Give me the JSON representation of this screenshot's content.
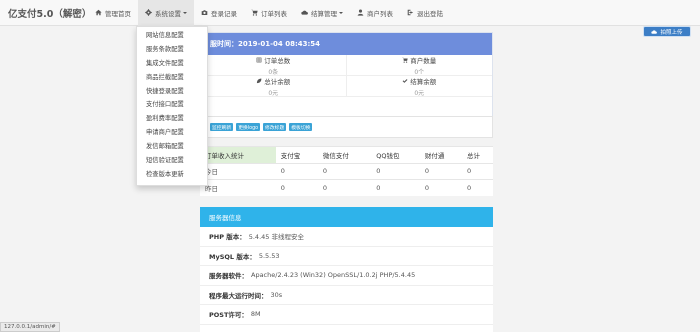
{
  "brand": "亿支付5.0（解密）",
  "nav": {
    "home": "管理首页",
    "settings": "系统设置",
    "login_log": "登录记录",
    "orders": "订单列表",
    "settlement": "结算管理",
    "merchants": "商户列表",
    "logout": "退出登陆"
  },
  "dropdown": [
    "网站信息配置",
    "服务条款配置",
    "集成文件配置",
    "商品拦截配置",
    "快捷登录配置",
    "支付接口配置",
    "盈利费率配置",
    "申请商户配置",
    "发信邮箱配置",
    "短信验证配置",
    "检查版本更新"
  ],
  "upload_label": "拍照上传",
  "overview": {
    "title": "服时间：2019-01-04 08:43:54",
    "stats": [
      {
        "icon": "grid-icon",
        "label": "订单总数",
        "value": "0条"
      },
      {
        "icon": "cart-icon",
        "label": "商户数量",
        "value": "0个"
      },
      {
        "icon": "leaf-icon",
        "label": "总计余额",
        "value": "0元"
      },
      {
        "icon": "check-icon",
        "label": "结算余额",
        "value": "0元"
      }
    ]
  },
  "actions": [
    "监控刷新",
    "更换logo",
    "修改标题",
    "模板切换"
  ],
  "revenue": {
    "headers": [
      "订单收入统计",
      "支付宝",
      "微信支付",
      "QQ钱包",
      "财付通",
      "总计"
    ],
    "rows": [
      [
        "今日",
        "0",
        "0",
        "0",
        "0",
        "0"
      ],
      [
        "昨日",
        "0",
        "0",
        "0",
        "0",
        "0"
      ]
    ]
  },
  "server": {
    "title": "服务器信息",
    "rows": [
      {
        "label": "PHP 版本：",
        "value": "5.4.45 非线程安全"
      },
      {
        "label": "MySQL 版本：",
        "value": "5.5.53"
      },
      {
        "label": "服务器软件：",
        "value": "Apache/2.4.23 (Win32) OpenSSL/1.0.2j PHP/5.4.45"
      },
      {
        "label": "程序最大运行时间：",
        "value": "30s"
      },
      {
        "label": "POST许可：",
        "value": "8M"
      }
    ]
  },
  "status_url": "127.0.0.1/admin/#"
}
